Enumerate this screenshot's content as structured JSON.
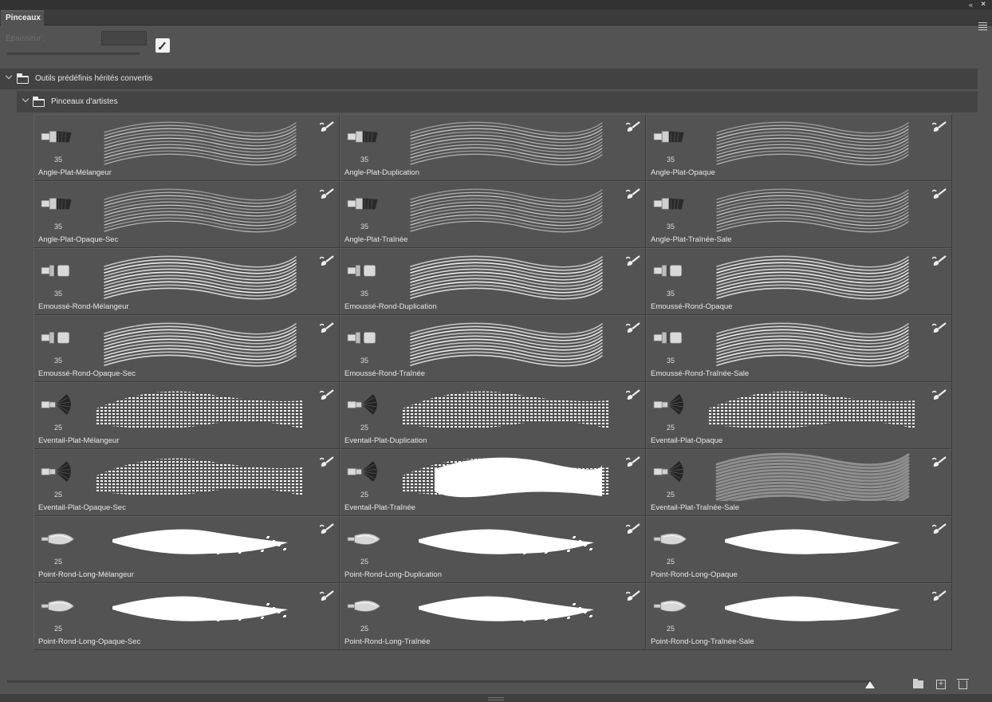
{
  "panel": {
    "tab_label": "Pinceaux",
    "thickness_label": "Epaisseur :",
    "collapse_glyph": "«",
    "close_glyph": "×"
  },
  "groups": {
    "parent_label": "Outils prédéfinis hérités convertis",
    "child_label": "Pinceaux d'artistes"
  },
  "brushes": [
    {
      "name": "Angle-Plat-Mélangeur",
      "size": "35",
      "tip": "angle",
      "stroke": "bristle"
    },
    {
      "name": "Angle-Plat-Duplication",
      "size": "35",
      "tip": "angle",
      "stroke": "bristle"
    },
    {
      "name": "Angle-Plat-Opaque",
      "size": "35",
      "tip": "angle",
      "stroke": "bristle"
    },
    {
      "name": "Angle-Plat-Opaque-Sec",
      "size": "35",
      "tip": "angle",
      "stroke": "bristle"
    },
    {
      "name": "Angle-Plat-Traînée",
      "size": "35",
      "tip": "angle",
      "stroke": "bristle"
    },
    {
      "name": "Angle-Plat-Traînée-Sale",
      "size": "35",
      "tip": "angle",
      "stroke": "bristle"
    },
    {
      "name": "Emoussé-Rond-Mélangeur",
      "size": "35",
      "tip": "round",
      "stroke": "bristle-bright"
    },
    {
      "name": "Emoussé-Rond-Duplication",
      "size": "35",
      "tip": "round",
      "stroke": "bristle-bright"
    },
    {
      "name": "Emoussé-Rond-Opaque",
      "size": "35",
      "tip": "round",
      "stroke": "bristle-bright"
    },
    {
      "name": "Emoussé-Rond-Opaque-Sec",
      "size": "35",
      "tip": "round",
      "stroke": "bristle-bright"
    },
    {
      "name": "Emoussé-Rond-Traînée",
      "size": "35",
      "tip": "round",
      "stroke": "bristle-bright"
    },
    {
      "name": "Emoussé-Rond-Traînée-Sale",
      "size": "35",
      "tip": "round",
      "stroke": "bristle-bright"
    },
    {
      "name": "Eventail-Plat-Mélangeur",
      "size": "25",
      "tip": "fan",
      "stroke": "dotted"
    },
    {
      "name": "Eventail-Plat-Duplication",
      "size": "25",
      "tip": "fan",
      "stroke": "dotted"
    },
    {
      "name": "Eventail-Plat-Opaque",
      "size": "25",
      "tip": "fan",
      "stroke": "dotted"
    },
    {
      "name": "Eventail-Plat-Opaque-Sec",
      "size": "25",
      "tip": "fan",
      "stroke": "dotted"
    },
    {
      "name": "Eventail-Plat-Traînée",
      "size": "25",
      "tip": "fan",
      "stroke": "dotted-solid"
    },
    {
      "name": "Eventail-Plat-Traînée-Sale",
      "size": "25",
      "tip": "fan",
      "stroke": "soft"
    },
    {
      "name": "Point-Rond-Long-Mélangeur",
      "size": "25",
      "tip": "point",
      "stroke": "solid"
    },
    {
      "name": "Point-Rond-Long-Duplication",
      "size": "25",
      "tip": "point",
      "stroke": "solid"
    },
    {
      "name": "Point-Rond-Long-Opaque",
      "size": "25",
      "tip": "point",
      "stroke": "solid-smooth"
    },
    {
      "name": "Point-Rond-Long-Opaque-Sec",
      "size": "25",
      "tip": "point",
      "stroke": "solid"
    },
    {
      "name": "Point-Rond-Long-Traînée",
      "size": "25",
      "tip": "point",
      "stroke": "solid"
    },
    {
      "name": "Point-Rond-Long-Traînée-Sale",
      "size": "25",
      "tip": "point",
      "stroke": "solid-smooth"
    }
  ],
  "icons": {
    "collapse": "double-chevron-left-icon",
    "close": "close-icon",
    "menu": "panel-menu-icon",
    "edit_brush": "brush-settings-icon",
    "folder": "folder-icon",
    "new_group": "new-group-icon",
    "new_brush": "new-brush-icon",
    "delete": "trash-icon",
    "brush_mode": "mixer-brush-icon"
  },
  "colors": {
    "panel_bg": "#535353",
    "dark_bg": "#3b3b3b",
    "text": "#e6e6e6",
    "disabled_text": "#6f6f6f"
  }
}
